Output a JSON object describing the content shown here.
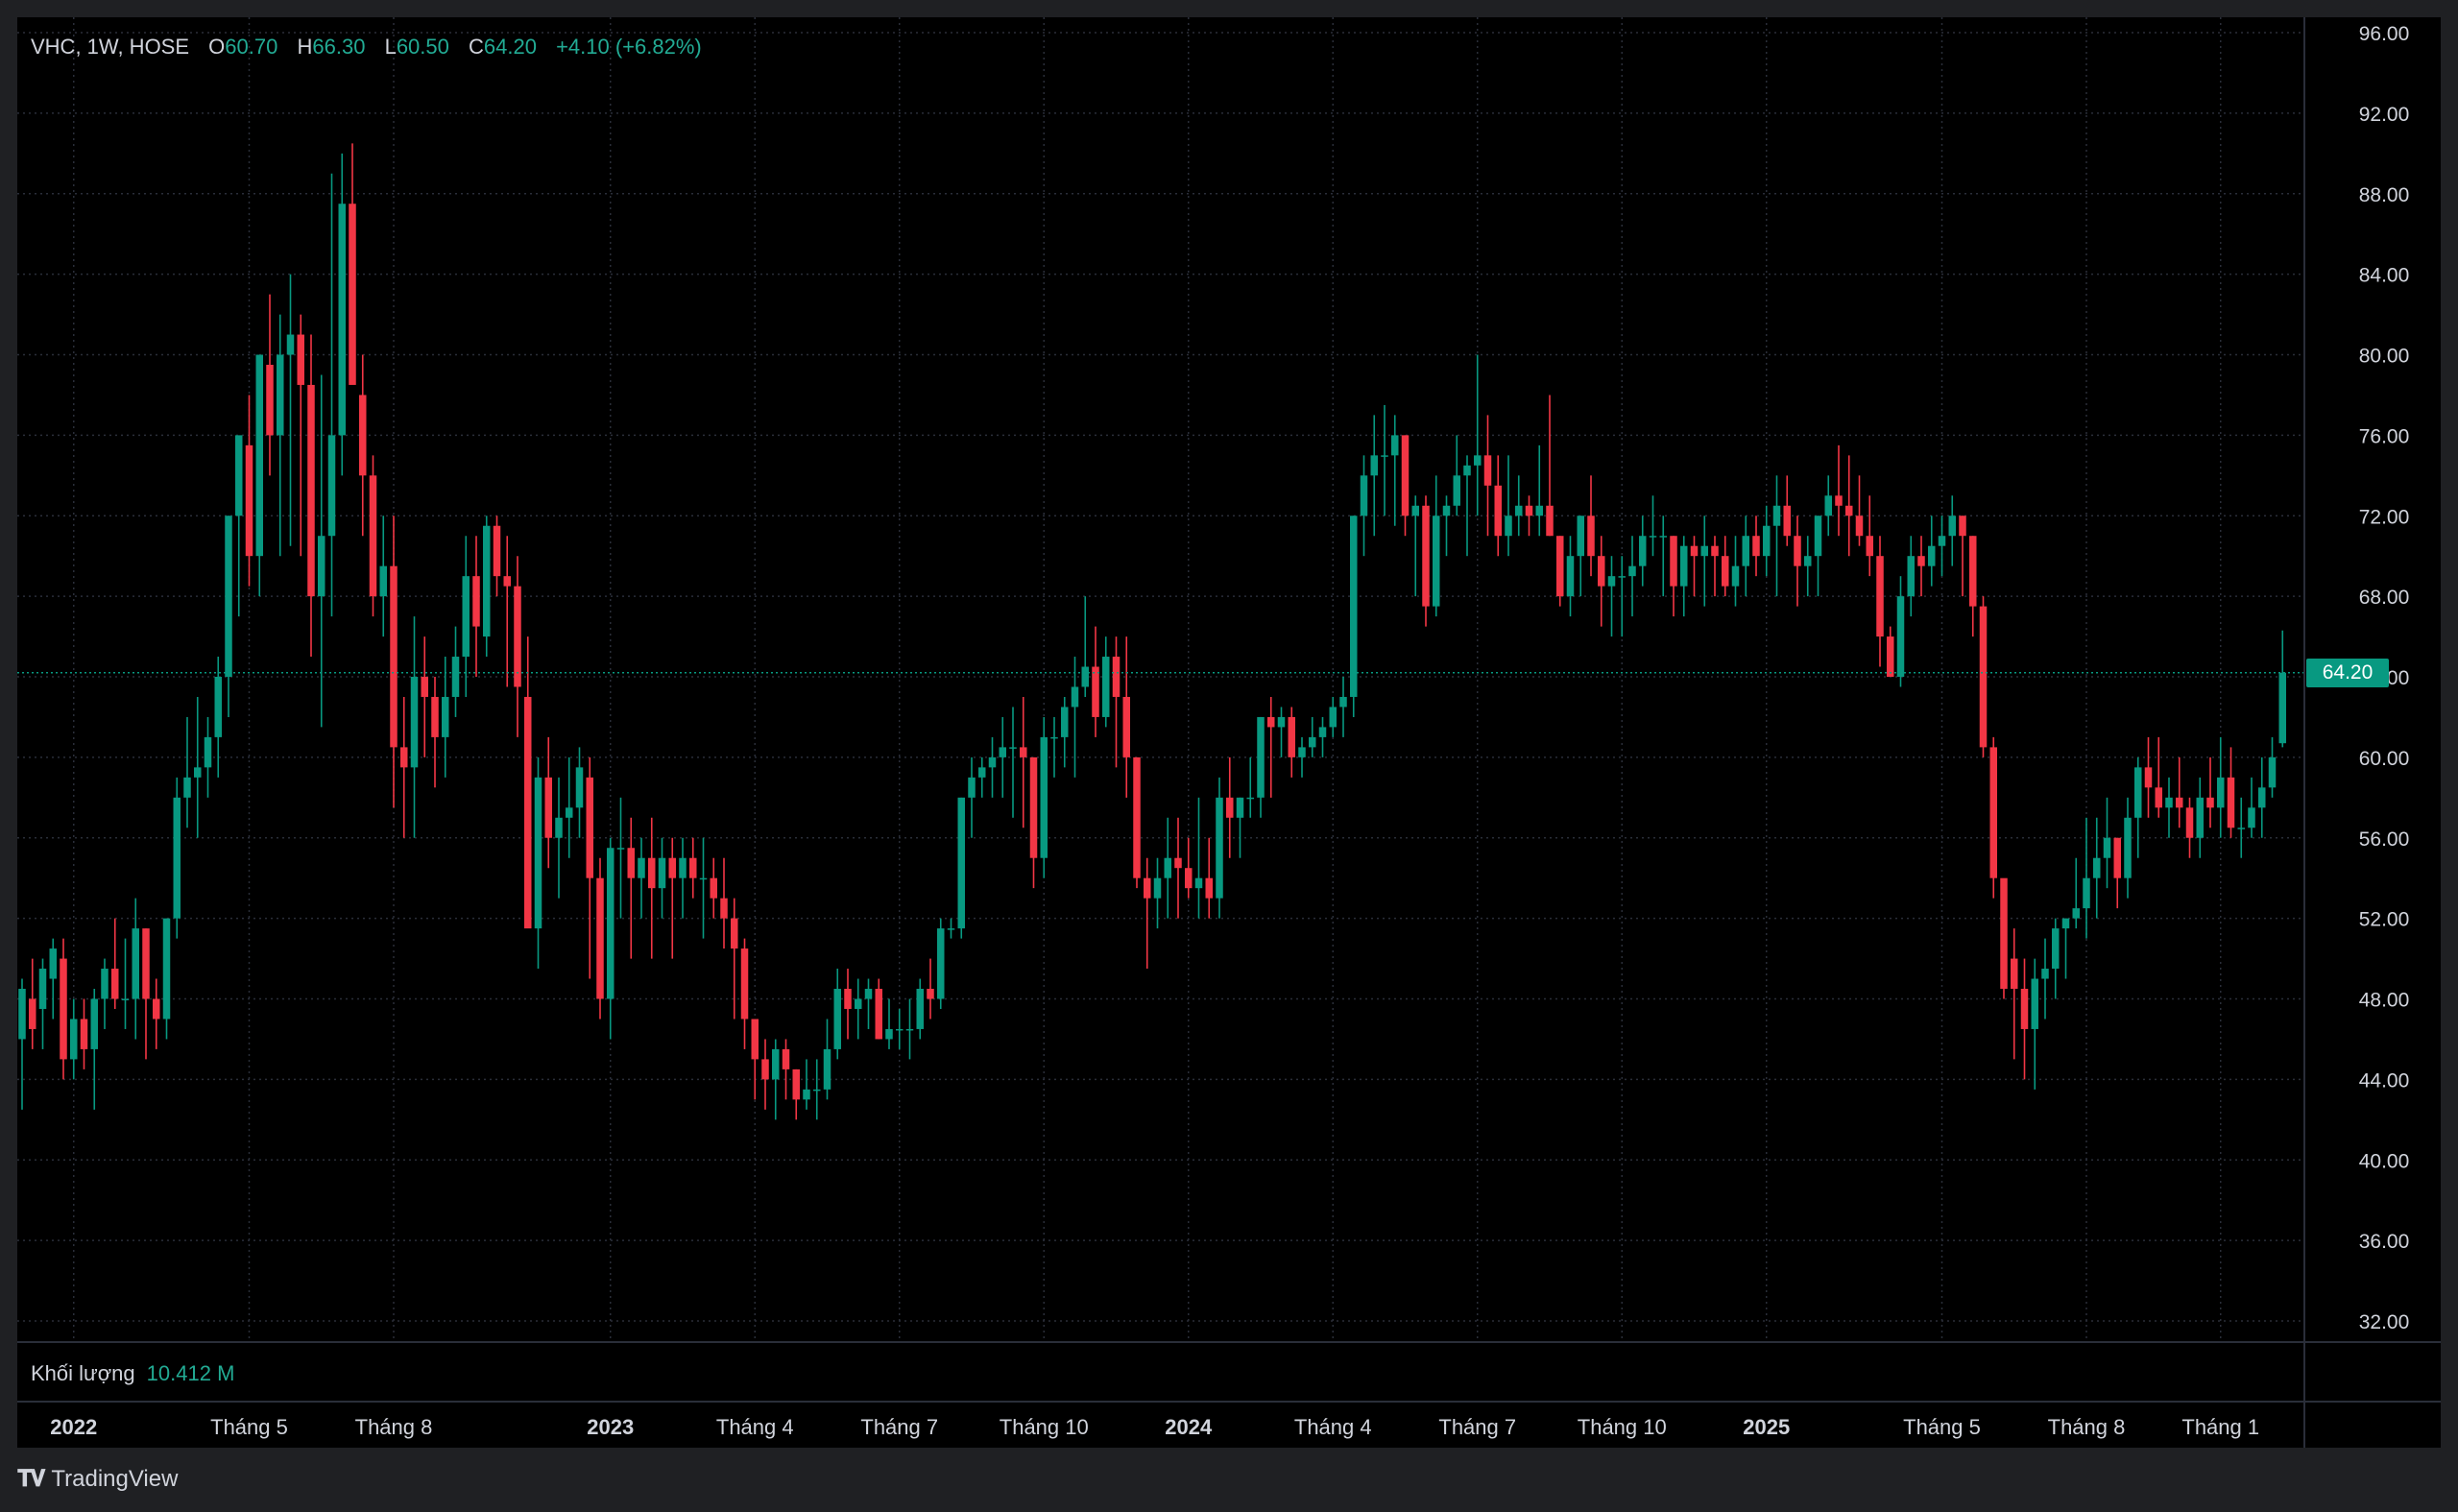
{
  "legend": {
    "symbol": "VHC, 1W, HOSE",
    "o_label": "O",
    "o_value": "60.70",
    "h_label": "H",
    "h_value": "66.30",
    "l_label": "L",
    "l_value": "60.50",
    "c_label": "C",
    "c_value": "64.20",
    "change": "+4.10 (+6.82%)"
  },
  "volume": {
    "label": "Khối lượng",
    "value": "10.412 M"
  },
  "brand": {
    "name": "TradingView"
  },
  "last_price": "64.20",
  "colors": {
    "up": "#089981",
    "down": "#f23645",
    "grid": "#2a2e39",
    "text": "#d1d4dc",
    "background": "#000000"
  },
  "chart_data": {
    "type": "candlestick",
    "title": "VHC, 1W, HOSE",
    "y_ticks": [
      "96.00",
      "92.00",
      "88.00",
      "84.00",
      "80.00",
      "76.00",
      "72.00",
      "68.00",
      "64.00",
      "60.00",
      "56.00",
      "52.00",
      "48.00",
      "44.00",
      "40.00",
      "36.00",
      "32.00"
    ],
    "ylim": [
      32,
      96
    ],
    "x_ticks": [
      {
        "label": "2022",
        "bold": true,
        "week": 5
      },
      {
        "label": "Tháng 5",
        "bold": false,
        "week": 22
      },
      {
        "label": "Tháng 8",
        "bold": false,
        "week": 36
      },
      {
        "label": "2023",
        "bold": true,
        "week": 57
      },
      {
        "label": "Tháng 4",
        "bold": false,
        "week": 71
      },
      {
        "label": "Tháng 7",
        "bold": false,
        "week": 85
      },
      {
        "label": "Tháng 10",
        "bold": false,
        "week": 99
      },
      {
        "label": "2024",
        "bold": true,
        "week": 113
      },
      {
        "label": "Tháng 4",
        "bold": false,
        "week": 127
      },
      {
        "label": "Tháng 7",
        "bold": false,
        "week": 141
      },
      {
        "label": "Tháng 10",
        "bold": false,
        "week": 155
      },
      {
        "label": "2025",
        "bold": true,
        "week": 169
      },
      {
        "label": "Tháng 5",
        "bold": false,
        "week": 186
      },
      {
        "label": "Tháng 8",
        "bold": false,
        "week": 200
      },
      {
        "label": "Tháng 1",
        "bold": false,
        "week": 213
      }
    ],
    "grid": true,
    "candles": [
      [
        46,
        49,
        42.5,
        48.5
      ],
      [
        48,
        50,
        45.5,
        46.5
      ],
      [
        47.5,
        50,
        45.5,
        49.5
      ],
      [
        49,
        51,
        47,
        50.5
      ],
      [
        50,
        51,
        44,
        45
      ],
      [
        45,
        48,
        44,
        47
      ],
      [
        47,
        48,
        44.5,
        45.5
      ],
      [
        45.5,
        48.5,
        42.5,
        48
      ],
      [
        48,
        50,
        46.5,
        49.5
      ],
      [
        49.5,
        52,
        47.5,
        48
      ],
      [
        48,
        51,
        46.5,
        48
      ],
      [
        48,
        53,
        46,
        51.5
      ],
      [
        51.5,
        51.5,
        45,
        48
      ],
      [
        48,
        49,
        45.5,
        47
      ],
      [
        47,
        52,
        46,
        52
      ],
      [
        52,
        59,
        51,
        58
      ],
      [
        58,
        62,
        56.5,
        59
      ],
      [
        59,
        63,
        56,
        59.5
      ],
      [
        59.5,
        62,
        58,
        61
      ],
      [
        61,
        65,
        59,
        64
      ],
      [
        64,
        72,
        62,
        72
      ],
      [
        72,
        74,
        67,
        76
      ],
      [
        75.5,
        78,
        68.5,
        70
      ],
      [
        70,
        80,
        68,
        80
      ],
      [
        79.5,
        83,
        74,
        76
      ],
      [
        76,
        82,
        70,
        80
      ],
      [
        80,
        84,
        70.5,
        81
      ],
      [
        81,
        82,
        70,
        78.5
      ],
      [
        78.5,
        81,
        65,
        68
      ],
      [
        68,
        79,
        61.5,
        71
      ],
      [
        71,
        89,
        67,
        76
      ],
      [
        76,
        90,
        74,
        87.5
      ],
      [
        87.5,
        90.5,
        79,
        78.5
      ],
      [
        78,
        80,
        71,
        74
      ],
      [
        74,
        75,
        67,
        68
      ],
      [
        68,
        72,
        66,
        69.5
      ],
      [
        69.5,
        72,
        57.5,
        60.5
      ],
      [
        60.5,
        63,
        56,
        59.5
      ],
      [
        59.5,
        67,
        56,
        64
      ],
      [
        64,
        66,
        60,
        63
      ],
      [
        63,
        64,
        58.5,
        61
      ],
      [
        61,
        65,
        59,
        63
      ],
      [
        63,
        66.5,
        62,
        65
      ],
      [
        65,
        71,
        63,
        69
      ],
      [
        69,
        71,
        64,
        66.5
      ],
      [
        66,
        72,
        65,
        71.5
      ],
      [
        71.5,
        72,
        68,
        69
      ],
      [
        69,
        71,
        63.5,
        68.5
      ],
      [
        68.5,
        70,
        61,
        63.5
      ],
      [
        63,
        66,
        56,
        51.5
      ],
      [
        51.5,
        60,
        49.5,
        59
      ],
      [
        59,
        61,
        54.5,
        56
      ],
      [
        56,
        59,
        53,
        57
      ],
      [
        57,
        60,
        55,
        57.5
      ],
      [
        57.5,
        60.5,
        56,
        59.5
      ],
      [
        59,
        60,
        49,
        54
      ],
      [
        54,
        55,
        47,
        48
      ],
      [
        48,
        56,
        46,
        55.5
      ],
      [
        55.5,
        58,
        52,
        55.5
      ],
      [
        55.5,
        57,
        50,
        54
      ],
      [
        54,
        56,
        52,
        55
      ],
      [
        55,
        57,
        50,
        53.5
      ],
      [
        53.5,
        56,
        52,
        55
      ],
      [
        55,
        56,
        50,
        54
      ],
      [
        54,
        56,
        52,
        55
      ],
      [
        55,
        56,
        53,
        54
      ],
      [
        54,
        56,
        51,
        54
      ],
      [
        54,
        55,
        52,
        53
      ],
      [
        53,
        55,
        50.5,
        52
      ],
      [
        52,
        53,
        47,
        50.5
      ],
      [
        50.5,
        51,
        45.5,
        47
      ],
      [
        47,
        47,
        43,
        45
      ],
      [
        45,
        46,
        42.5,
        44
      ],
      [
        44,
        46,
        42,
        45.5
      ],
      [
        45.5,
        46,
        43,
        44.5
      ],
      [
        44.5,
        44.5,
        42,
        43
      ],
      [
        43,
        45,
        42.5,
        43.5
      ],
      [
        43.5,
        45,
        42,
        43.5
      ],
      [
        43.5,
        47,
        43,
        45.5
      ],
      [
        45.5,
        49.5,
        45,
        48.5
      ],
      [
        48.5,
        49.5,
        46,
        47.5
      ],
      [
        47.5,
        49,
        46,
        48
      ],
      [
        48,
        49,
        46.5,
        48.5
      ],
      [
        48.5,
        49,
        46,
        46
      ],
      [
        46,
        48,
        45.5,
        46.5
      ],
      [
        46.5,
        47.5,
        45.5,
        46.5
      ],
      [
        46.5,
        48,
        45,
        46.5
      ],
      [
        46.5,
        49,
        46,
        48.5
      ],
      [
        48.5,
        50,
        47,
        48
      ],
      [
        48,
        52,
        47.5,
        51.5
      ],
      [
        51.5,
        52,
        51,
        51.5
      ],
      [
        51.5,
        58,
        51,
        58
      ],
      [
        58,
        60,
        56,
        59
      ],
      [
        59,
        60,
        58,
        59.5
      ],
      [
        59.5,
        61,
        58,
        60
      ],
      [
        60,
        62,
        58,
        60.5
      ],
      [
        60.5,
        62.5,
        57,
        60.5
      ],
      [
        60.5,
        63,
        56.5,
        60
      ],
      [
        60,
        60,
        53.5,
        55
      ],
      [
        55,
        62,
        54,
        61
      ],
      [
        61,
        62,
        59,
        61
      ],
      [
        61,
        63,
        59.5,
        62.5
      ],
      [
        62.5,
        65,
        59,
        63.5
      ],
      [
        63.5,
        68,
        63,
        64.5
      ],
      [
        64.5,
        66.5,
        61,
        62
      ],
      [
        62,
        66,
        61.5,
        65
      ],
      [
        65,
        66,
        59.5,
        63
      ],
      [
        63,
        66,
        58,
        60
      ],
      [
        60,
        60,
        53.5,
        54
      ],
      [
        54,
        55,
        49.5,
        53
      ],
      [
        53,
        55,
        51.5,
        54
      ],
      [
        54,
        57,
        52,
        55
      ],
      [
        55,
        57,
        52,
        54.5
      ],
      [
        54.5,
        56,
        53,
        53.5
      ],
      [
        53.5,
        58,
        52,
        54
      ],
      [
        54,
        56,
        52,
        53
      ],
      [
        53,
        59,
        52,
        58
      ],
      [
        58,
        60,
        55,
        57
      ],
      [
        57,
        58,
        55,
        58
      ],
      [
        58,
        60,
        57,
        58
      ],
      [
        58,
        62,
        57,
        62
      ],
      [
        62,
        63,
        58,
        61.5
      ],
      [
        61.5,
        62.5,
        60,
        62
      ],
      [
        62,
        62.5,
        59,
        60
      ],
      [
        60,
        61,
        59,
        60.5
      ],
      [
        60.5,
        62,
        60,
        61
      ],
      [
        61,
        62,
        60,
        61.5
      ],
      [
        61.5,
        63,
        61,
        62.5
      ],
      [
        62.5,
        64,
        61,
        63
      ],
      [
        63,
        72,
        62,
        72
      ],
      [
        72,
        75,
        70,
        74
      ],
      [
        74,
        77,
        71,
        75
      ],
      [
        75,
        77.5,
        72,
        75
      ],
      [
        75,
        77,
        71.5,
        76
      ],
      [
        76,
        76,
        71,
        72
      ],
      [
        72,
        73,
        68,
        72.5
      ],
      [
        72.5,
        73,
        66.5,
        67.5
      ],
      [
        67.5,
        74,
        67,
        72
      ],
      [
        72,
        73,
        70,
        72.5
      ],
      [
        72.5,
        76,
        72,
        74
      ],
      [
        74,
        75,
        70,
        74.5
      ],
      [
        74.5,
        80,
        72,
        75
      ],
      [
        75,
        77,
        71,
        73.5
      ],
      [
        73.5,
        75,
        70,
        71
      ],
      [
        71,
        75,
        70,
        72
      ],
      [
        72,
        74,
        71,
        72.5
      ],
      [
        72.5,
        73,
        71,
        72
      ],
      [
        72,
        75.5,
        71,
        72.5
      ],
      [
        72.5,
        78,
        71,
        71
      ],
      [
        71,
        71,
        67.5,
        68
      ],
      [
        68,
        71,
        67,
        70
      ],
      [
        70,
        72,
        68,
        72
      ],
      [
        72,
        74,
        69,
        70
      ],
      [
        70,
        71,
        66.5,
        68.5
      ],
      [
        68.5,
        70,
        66,
        69
      ],
      [
        69,
        70,
        66,
        69
      ],
      [
        69,
        71,
        67,
        69.5
      ],
      [
        69.5,
        72,
        68.5,
        71
      ],
      [
        71,
        73,
        70,
        71
      ],
      [
        71,
        72,
        68,
        71
      ],
      [
        71,
        71,
        67,
        68.5
      ],
      [
        68.5,
        71,
        67,
        70.5
      ],
      [
        70.5,
        71,
        68,
        70
      ],
      [
        70,
        72,
        67.5,
        70.5
      ],
      [
        70.5,
        71,
        68,
        70
      ],
      [
        70,
        71,
        68,
        68.5
      ],
      [
        68.5,
        71,
        67.5,
        69.5
      ],
      [
        69.5,
        72,
        68,
        71
      ],
      [
        71,
        72,
        69,
        70
      ],
      [
        70,
        72.5,
        69,
        71.5
      ],
      [
        71.5,
        74,
        68,
        72.5
      ],
      [
        72.5,
        74,
        70.5,
        71
      ],
      [
        71,
        72,
        67.5,
        69.5
      ],
      [
        69.5,
        71,
        68,
        70
      ],
      [
        70,
        72,
        68,
        72
      ],
      [
        72,
        74,
        71,
        73
      ],
      [
        73,
        75.5,
        71,
        72.5
      ],
      [
        72.5,
        75,
        70,
        72
      ],
      [
        72,
        74,
        70.5,
        71
      ],
      [
        71,
        73,
        69,
        70
      ],
      [
        70,
        71,
        64.5,
        66
      ],
      [
        66,
        66.5,
        64,
        64
      ],
      [
        64,
        69,
        63.5,
        68
      ],
      [
        68,
        71,
        67,
        70
      ],
      [
        70,
        71,
        68,
        69.5
      ],
      [
        69.5,
        72,
        68.5,
        70.5
      ],
      [
        70.5,
        72,
        69,
        71
      ],
      [
        71,
        73,
        69.5,
        72
      ],
      [
        72,
        72,
        68,
        71
      ],
      [
        71,
        71,
        66,
        67.5
      ],
      [
        67.5,
        68,
        60,
        60.5
      ],
      [
        60.5,
        61,
        53,
        54
      ],
      [
        54,
        53,
        48,
        48.5
      ],
      [
        50,
        51.5,
        45,
        48.5
      ],
      [
        48.5,
        50,
        44,
        46.5
      ],
      [
        46.5,
        50,
        43.5,
        49
      ],
      [
        49,
        51,
        47,
        49.5
      ],
      [
        49.5,
        52,
        48,
        51.5
      ],
      [
        51.5,
        52,
        49,
        52
      ],
      [
        52,
        55,
        51.5,
        52.5
      ],
      [
        52.5,
        57,
        51,
        54
      ],
      [
        54,
        57,
        52,
        55
      ],
      [
        55,
        58,
        53.5,
        56
      ],
      [
        56,
        56,
        52.5,
        54
      ],
      [
        54,
        58,
        53,
        57
      ],
      [
        57,
        60,
        55,
        59.5
      ],
      [
        59.5,
        61,
        57,
        58.5
      ],
      [
        58.5,
        61,
        57,
        57.5
      ],
      [
        57.5,
        59,
        56,
        58
      ],
      [
        58,
        60,
        56.5,
        57.5
      ],
      [
        57.5,
        58,
        55,
        56
      ],
      [
        56,
        59,
        55,
        58
      ],
      [
        58,
        60,
        56.5,
        57.5
      ],
      [
        57.5,
        61,
        56,
        59
      ],
      [
        59,
        60.5,
        56,
        56.5
      ],
      [
        56.5,
        58,
        55,
        56.5
      ],
      [
        56.5,
        59,
        56,
        57.5
      ],
      [
        57.5,
        60,
        56,
        58.5
      ],
      [
        58.5,
        61,
        58,
        60
      ],
      [
        60.7,
        66.3,
        60.5,
        64.2
      ]
    ]
  }
}
